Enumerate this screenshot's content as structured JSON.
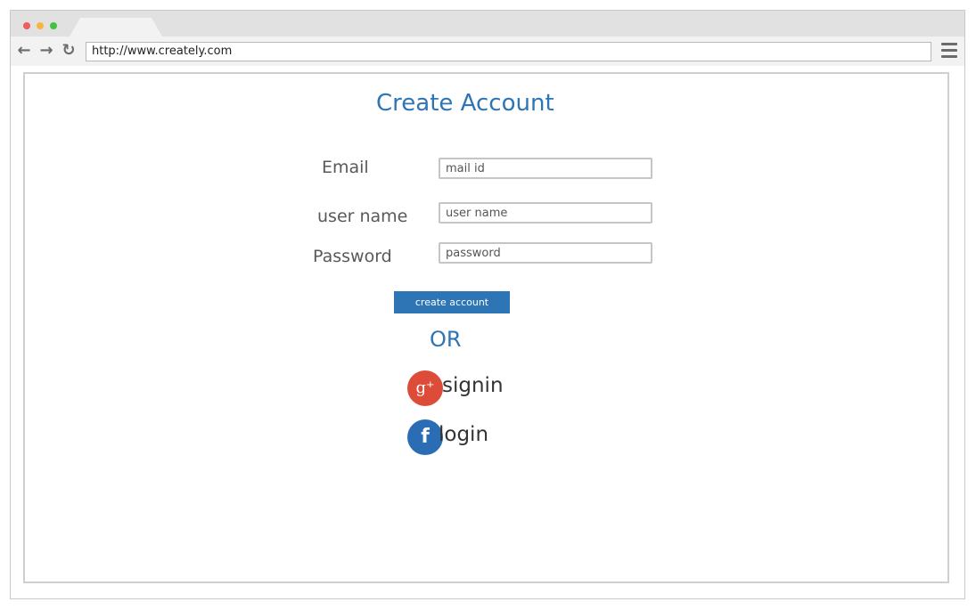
{
  "browser": {
    "dots": [
      "#ee5c5c",
      "#f4b73c",
      "#43c143"
    ],
    "nav": {
      "back_icon": "arrow-left",
      "forward_icon": "arrow-right",
      "reload_icon": "reload"
    },
    "address_url": "http://www.creately.com",
    "menu_icon": "hamburger-menu"
  },
  "form": {
    "title": "Create Account",
    "email_label": "Email",
    "email_placeholder": "mail id",
    "username_label": "user name",
    "username_placeholder": "user name",
    "password_label": "Password",
    "password_placeholder": "password",
    "create_button": "create account",
    "or_text": "OR"
  },
  "social": {
    "google": {
      "icon_text": "g⁺",
      "label": "signin",
      "color": "#dd4b39"
    },
    "facebook": {
      "icon_text": "f",
      "label": "login",
      "color": "#2a6db5"
    }
  },
  "colors": {
    "accent": "#2e75b6",
    "label": "#595959"
  }
}
